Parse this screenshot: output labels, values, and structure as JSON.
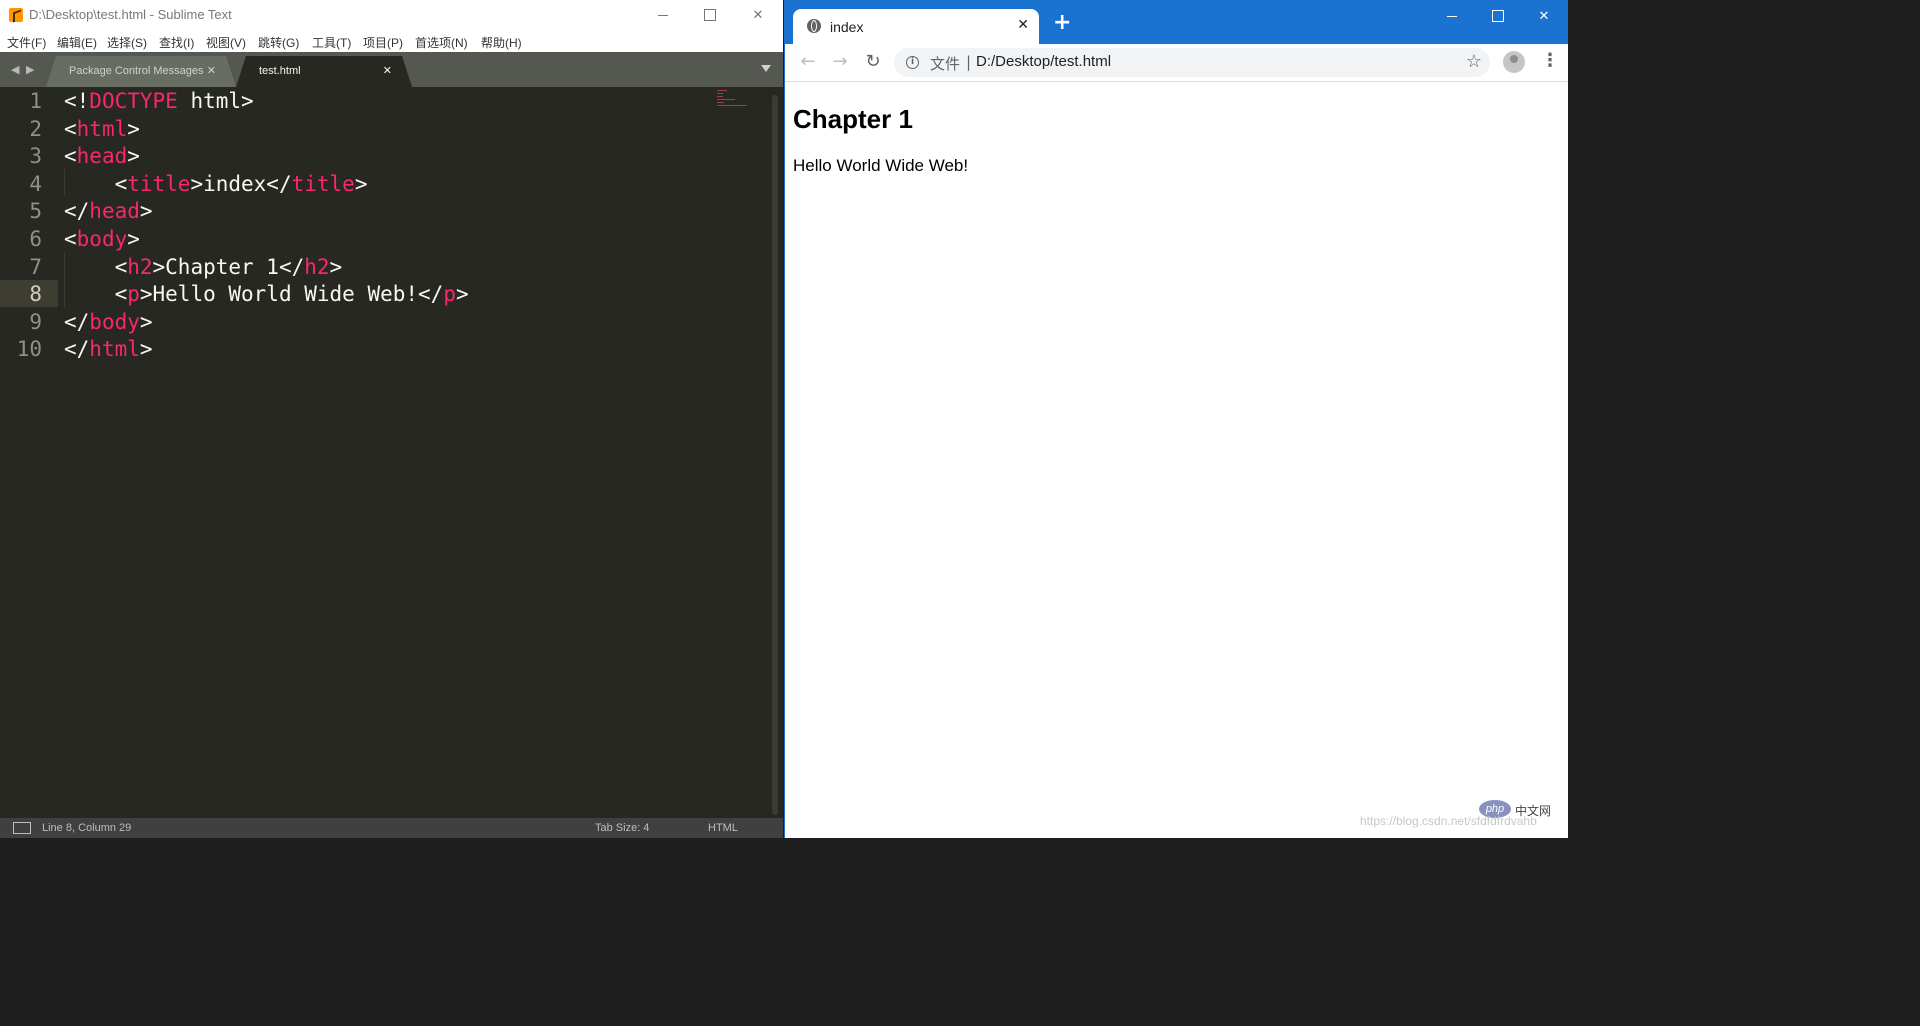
{
  "sublime": {
    "window_title": "D:\\Desktop\\test.html - Sublime Text",
    "menu": [
      "文件(F)",
      "编辑(E)",
      "选择(S)",
      "查找(I)",
      "视图(V)",
      "跳转(G)",
      "工具(T)",
      "项目(P)",
      "首选项(N)",
      "帮助(H)"
    ],
    "tabs": [
      {
        "label": "Package Control Messages",
        "active": false
      },
      {
        "label": "test.html",
        "active": true
      }
    ],
    "code_lines": [
      {
        "n": "1",
        "parts": [
          [
            "p",
            "<!"
          ],
          [
            "t",
            "DOCTYPE"
          ],
          [
            "p",
            " html>"
          ]
        ]
      },
      {
        "n": "2",
        "parts": [
          [
            "p",
            "<"
          ],
          [
            "t",
            "html"
          ],
          [
            "p",
            ">"
          ]
        ]
      },
      {
        "n": "3",
        "parts": [
          [
            "p",
            "<"
          ],
          [
            "t",
            "head"
          ],
          [
            "p",
            ">"
          ]
        ]
      },
      {
        "n": "4",
        "parts": [
          [
            "p",
            "    <"
          ],
          [
            "t",
            "title"
          ],
          [
            "p",
            ">index</"
          ],
          [
            "t",
            "title"
          ],
          [
            "p",
            ">"
          ]
        ]
      },
      {
        "n": "5",
        "parts": [
          [
            "p",
            "</"
          ],
          [
            "t",
            "head"
          ],
          [
            "p",
            ">"
          ]
        ]
      },
      {
        "n": "6",
        "parts": [
          [
            "p",
            "<"
          ],
          [
            "t",
            "body"
          ],
          [
            "p",
            ">"
          ]
        ]
      },
      {
        "n": "7",
        "parts": [
          [
            "p",
            "    <"
          ],
          [
            "t",
            "h2"
          ],
          [
            "p",
            ">Chapter 1</"
          ],
          [
            "t",
            "h2"
          ],
          [
            "p",
            ">"
          ]
        ]
      },
      {
        "n": "8",
        "parts": [
          [
            "p",
            "    <"
          ],
          [
            "t",
            "p"
          ],
          [
            "p",
            ">Hello World Wide Web!</"
          ],
          [
            "t",
            "p"
          ],
          [
            "p",
            ">"
          ]
        ]
      },
      {
        "n": "9",
        "parts": [
          [
            "p",
            "</"
          ],
          [
            "t",
            "body"
          ],
          [
            "p",
            ">"
          ]
        ]
      },
      {
        "n": "10",
        "parts": [
          [
            "p",
            "</"
          ],
          [
            "t",
            "html"
          ],
          [
            "p",
            ">"
          ]
        ]
      }
    ],
    "current_line": 8,
    "status": {
      "position": "Line 8, Column 29",
      "tab_size": "Tab Size: 4",
      "syntax": "HTML"
    },
    "colors": {
      "tag": "#f92672",
      "text": "#f8f8f2",
      "background": "#272822"
    }
  },
  "browser": {
    "tab_title": "index",
    "address": {
      "scheme_label": "文件",
      "separator": "|",
      "url": "D:/Desktop/test.html"
    },
    "page": {
      "heading": "Chapter 1",
      "paragraph": "Hello World Wide Web!"
    },
    "watermark": "https://blog.csdn.net/sfdfdfrdvahb",
    "php_logo": "php",
    "php_cn": "中文网",
    "icons": [
      "globe-icon",
      "close-icon",
      "plus-icon",
      "back-arrow-icon",
      "forward-arrow-icon",
      "reload-icon",
      "info-icon",
      "star-icon",
      "profile-icon",
      "menu-dots-icon"
    ],
    "accent_color": "#1a73d1"
  }
}
